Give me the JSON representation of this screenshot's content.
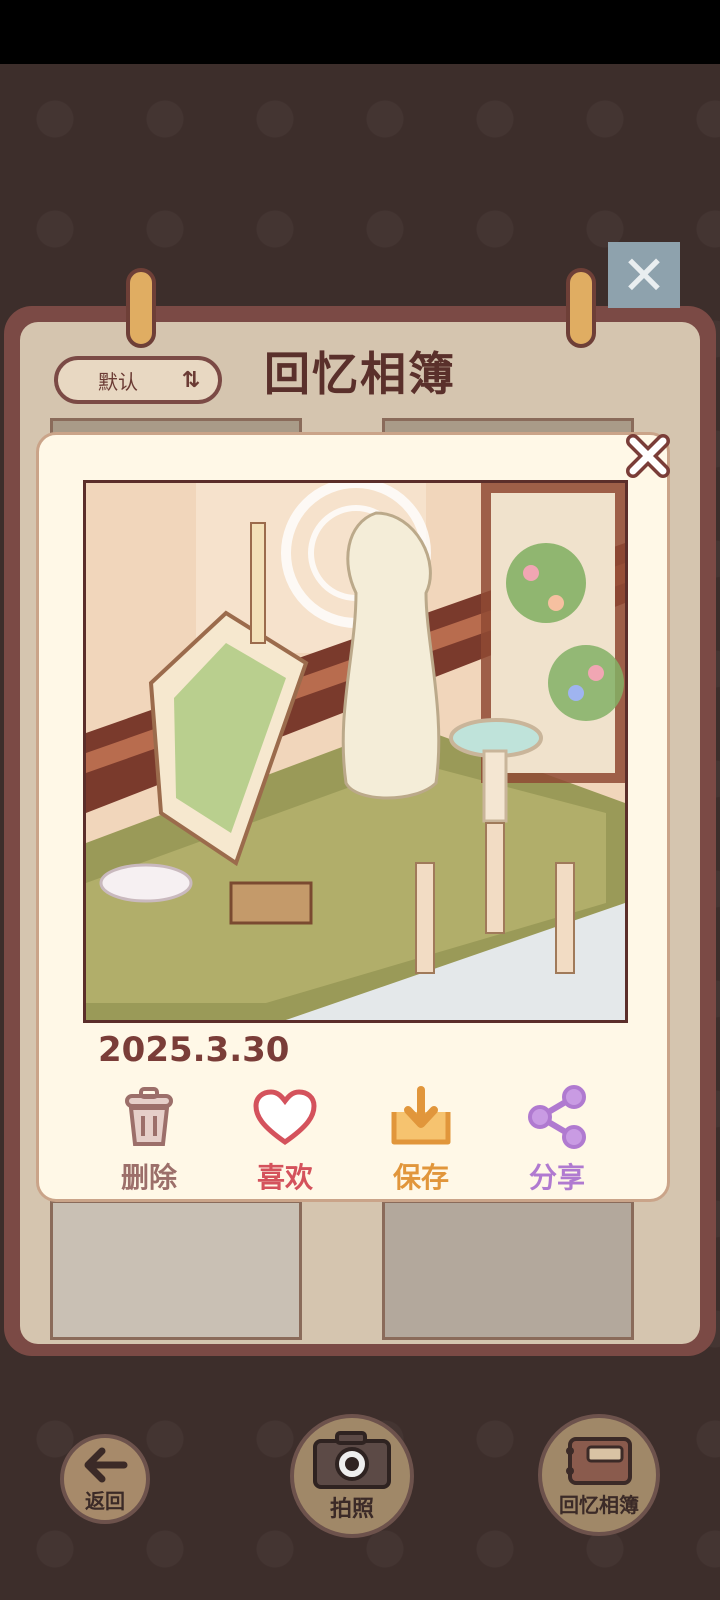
{
  "album": {
    "title": "回忆相簿",
    "sort_label": "默认",
    "sort_icon": "sort-icon",
    "close_icon": "close-icon"
  },
  "popup": {
    "date": "2025.3.30",
    "close_icon": "close-icon",
    "actions": [
      {
        "label": "删除",
        "icon": "trash-icon",
        "color": "#9c6f6a"
      },
      {
        "label": "喜欢",
        "icon": "heart-icon",
        "color": "#d4525c"
      },
      {
        "label": "保存",
        "icon": "download-icon",
        "color": "#e1963b"
      },
      {
        "label": "分享",
        "icon": "share-icon",
        "color": "#b07ad0"
      }
    ]
  },
  "bottom_bar": {
    "back_label": "返回",
    "photo_label": "拍照",
    "album_label": "回忆相簿"
  }
}
